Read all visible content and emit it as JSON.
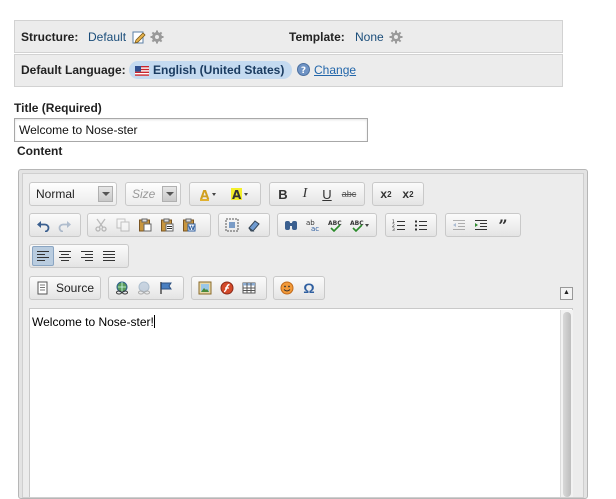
{
  "structure": {
    "label": "Structure:",
    "value": "Default"
  },
  "template": {
    "label": "Template:",
    "value": "None"
  },
  "language": {
    "label": "Default Language:",
    "value": "English (United States)",
    "change_label": "Change"
  },
  "title_field": {
    "label": "Title (Required)",
    "value": "Welcome to Nose-ster"
  },
  "content_label": "Content",
  "toolbar": {
    "format_combo": "Normal",
    "size_combo": "Size",
    "source_label": "Source"
  },
  "editor_content": "Welcome to Nose-ster!",
  "colors": {
    "accent": "#c4daf0",
    "link": "#2266aa"
  }
}
